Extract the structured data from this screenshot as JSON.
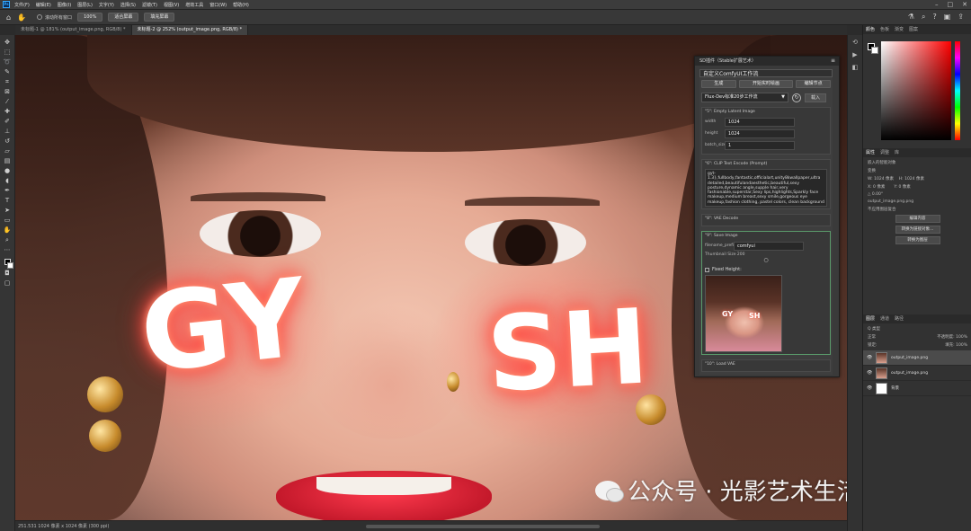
{
  "app": {
    "logo": "Ps"
  },
  "menu": [
    "文件(F)",
    "编辑(E)",
    "图像(I)",
    "图层(L)",
    "文字(Y)",
    "选择(S)",
    "滤镜(T)",
    "视图(V)",
    "增效工具",
    "窗口(W)",
    "帮助(H)"
  ],
  "options": {
    "scroll_all_label": "滚动所有窗口",
    "zoom_100": "100%",
    "fit_screen": "适合屏幕",
    "fill_screen": "填充屏幕"
  },
  "tabs": [
    {
      "label": "未标题-1 @ 181% (output_image.png, RGB/8) *",
      "active": false
    },
    {
      "label": "未标题-2 @ 252% (output_image.png, RGB/8) *",
      "active": true
    }
  ],
  "canvas": {
    "text_left": "GY",
    "text_right": "SH",
    "watermark": "公众号 · 光影艺术生活馆"
  },
  "status": {
    "text": "251.531 1024 像素 x 1024 像素 (300 ppi)"
  },
  "plugin": {
    "header": "SD插件（Stable扩展艺术）",
    "title": "自定义ComfyUI工作流",
    "buttons": [
      "生成",
      "开始实时绘画",
      "编辑节点"
    ],
    "workflow": "Flux-Dev标准20步工作流",
    "load_label": "载入",
    "empty_latent": {
      "title": "\"5\": Empty Latent Image",
      "width_label": "width",
      "width": "1024",
      "height_label": "height",
      "height": "1024",
      "batch_label": "batch_size",
      "batch": "1"
    },
    "clip": {
      "title": "\"6\": CLIP Text Encode (Prompt)",
      "prompt": "gyt-1.3},fullbody,fantastic,officialart,unity8kwallpaper,ultra detailed,beautifulandaesthetic,beautiful,sexy posture,dynamic angle,supple hair,very fashionable,superstar,Sexy lips,highlights,Sparkly face makeup,medium breast,sexy smile,gorgeous eye makeup,fashion clothing, pastel colors, clean background"
    },
    "vae_decode": "\"8\": VAE Decode",
    "save_image": {
      "title": "\"9\": Save Image",
      "prefix_label": "filename_prefix",
      "prefix": "comfyui",
      "thumb_label": "Thumbnail Size",
      "thumb_size": "200"
    },
    "fixed_height": "Fixed Height:",
    "thumb_text_left": "GY",
    "thumb_text_right": "SH",
    "load_vae": "\"10\": Load VAE"
  },
  "right": {
    "color_tabs": [
      "颜色",
      "色板",
      "渐变",
      "图案"
    ],
    "props_tabs": [
      "属性",
      "调整",
      "库"
    ],
    "props": {
      "smart_object": "嵌入的智能对象",
      "transform": "变换",
      "w": "W: 1024 像素",
      "h": "H: 1024 像素",
      "x": "X: 0 像素",
      "y": "Y: 0 像素",
      "angle": "△ 0.00°",
      "filename": "output_image.png.png",
      "layer_comp": "不应用图层复合",
      "btn1": "编辑内容",
      "btn2": "转换为链接对象...",
      "btn3": "转换为图层"
    },
    "layers_tabs": [
      "图层",
      "通道",
      "路径"
    ],
    "kind_label": "Q 类型",
    "blend_mode": "正常",
    "opacity": "不透明度: 100%",
    "lock_label": "锁定:",
    "fill": "填充: 100%",
    "layers": [
      {
        "name": "output_image.png",
        "selected": true
      },
      {
        "name": "output_image.png",
        "selected": false
      },
      {
        "name": "背景",
        "selected": false
      }
    ]
  }
}
